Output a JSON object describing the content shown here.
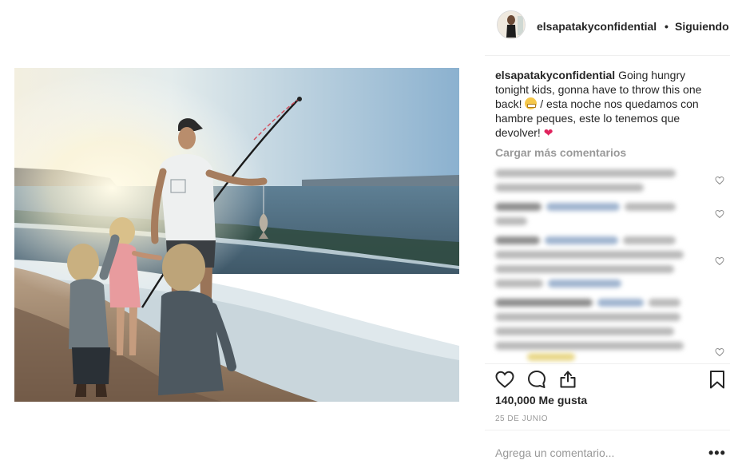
{
  "post": {
    "username": "elsapatakyconfidential",
    "separator": "•",
    "follow_status": "Siguiendo",
    "caption_before_emoji": "Going hungry tonight kids, gonna have to throw this one back! ",
    "caption_after_emoji": "/ esta noche nos quedamos con hambre peques, este lo tenemos que devolver! ",
    "caption_heart": "❤",
    "load_more": "Cargar más comentarios",
    "likes": "140,000 Me gusta",
    "date": "25 DE JUNIO",
    "add_comment_placeholder": "Agrega un comentario...",
    "more_options": "•••"
  },
  "icons": {
    "like": "heart-outline-icon",
    "comment": "comment-bubble-icon",
    "share": "share-icon",
    "save": "bookmark-icon",
    "comment_like": "small-heart-icon"
  },
  "colors": {
    "text": "#262626",
    "muted": "#999999",
    "divider": "#efefef",
    "heart_red": "#e0245e"
  }
}
